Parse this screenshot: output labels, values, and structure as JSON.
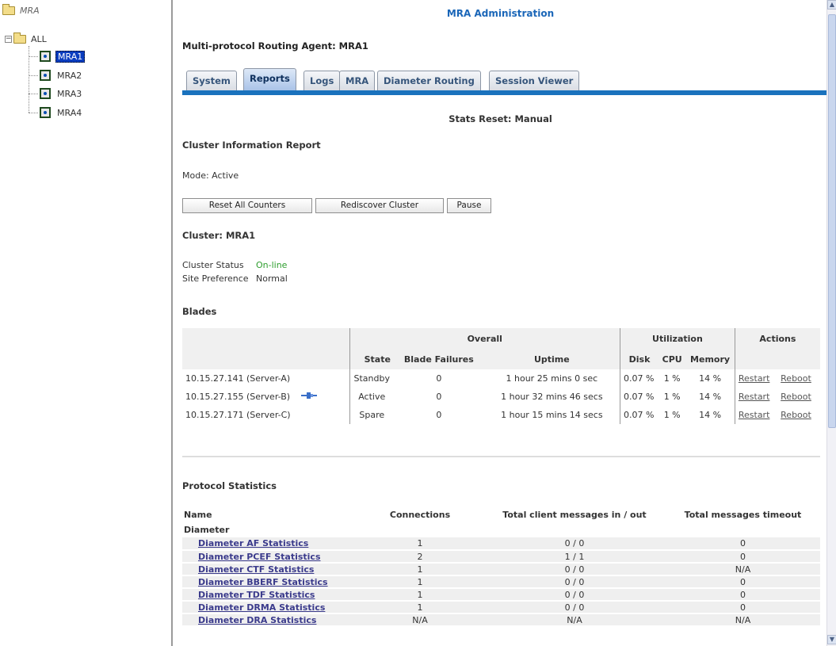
{
  "tree": {
    "root": "MRA",
    "group": "ALL",
    "items": [
      "MRA1",
      "MRA2",
      "MRA3",
      "MRA4"
    ],
    "selected": "MRA1"
  },
  "page": {
    "title": "MRA Administration",
    "agent_label": "Multi-protocol Routing Agent: MRA1"
  },
  "tabs": [
    "System",
    "Reports",
    "Logs",
    "MRA",
    "Diameter Routing",
    "Session Viewer"
  ],
  "active_tab": "Reports",
  "stats_reset": "Stats Reset: Manual",
  "report_title": "Cluster Information Report",
  "mode": "Mode: Active",
  "buttons": {
    "reset": "Reset All Counters",
    "rediscover": "Rediscover Cluster",
    "pause": "Pause"
  },
  "cluster": {
    "title": "Cluster: MRA1",
    "status_label": "Cluster Status",
    "status_value": "On-line",
    "site_label": "Site Preference",
    "site_value": "Normal"
  },
  "blades": {
    "title": "Blades",
    "group_overall": "Overall",
    "group_util": "Utilization",
    "group_actions": "Actions",
    "headers": [
      "State",
      "Blade Failures",
      "Uptime",
      "Disk",
      "CPU",
      "Memory"
    ],
    "rows": [
      {
        "server": "10.15.27.141 (Server-A)",
        "state": "Standby",
        "failures": "0",
        "uptime": "1 hour 25 mins 0 sec",
        "disk": "0.07 %",
        "cpu": "1 %",
        "mem": "14 %",
        "restart": "Restart",
        "reboot": "Reboot"
      },
      {
        "server": "10.15.27.155 (Server-B)",
        "state": "Active",
        "failures": "0",
        "uptime": "1 hour 32 mins 46 secs",
        "disk": "0.07 %",
        "cpu": "1 %",
        "mem": "14 %",
        "restart": "Restart",
        "reboot": "Reboot"
      },
      {
        "server": "10.15.27.171 (Server-C)",
        "state": "Spare",
        "failures": "0",
        "uptime": "1 hour 15 mins 14 secs",
        "disk": "0.07 %",
        "cpu": "1 %",
        "mem": "14 %",
        "restart": "Restart",
        "reboot": "Reboot"
      }
    ]
  },
  "protocol": {
    "title": "Protocol Statistics",
    "headers": [
      "Name",
      "Connections",
      "Total client messages in / out",
      "Total messages timeout"
    ],
    "group": "Diameter",
    "rows": [
      {
        "name": "Diameter AF Statistics",
        "conn": "1",
        "msgs": "0 / 0",
        "timeout": "0"
      },
      {
        "name": "Diameter PCEF Statistics",
        "conn": "2",
        "msgs": "1 / 1",
        "timeout": "0"
      },
      {
        "name": "Diameter CTF Statistics",
        "conn": "1",
        "msgs": "0 / 0",
        "timeout": "N/A"
      },
      {
        "name": "Diameter BBERF Statistics",
        "conn": "1",
        "msgs": "0 / 0",
        "timeout": "0"
      },
      {
        "name": "Diameter TDF Statistics",
        "conn": "1",
        "msgs": "0 / 0",
        "timeout": "0"
      },
      {
        "name": "Diameter DRMA Statistics",
        "conn": "1",
        "msgs": "0 / 0",
        "timeout": "0"
      },
      {
        "name": "Diameter DRA Statistics",
        "conn": "N/A",
        "msgs": "N/A",
        "timeout": "N/A"
      }
    ]
  },
  "colors": {
    "accent": "#1a66b8",
    "online": "#2e9e2e",
    "tab_bar": "#1a72bd"
  }
}
